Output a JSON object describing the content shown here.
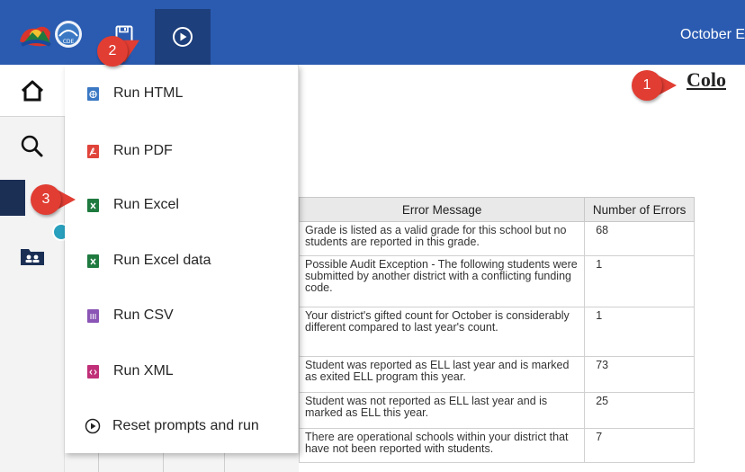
{
  "topbar": {
    "title": "October E",
    "logo_icon": "colorado-cde-logo-icon",
    "save_icon": "save-icon",
    "run_icon": "play-circle-icon"
  },
  "leftnav": {
    "items": [
      {
        "icon": "home-icon"
      },
      {
        "icon": "search-icon"
      },
      {
        "icon": "content-icon"
      },
      {
        "icon": "team-folder-icon"
      }
    ]
  },
  "page": {
    "heading": "Colo"
  },
  "run_menu": {
    "items": [
      {
        "label": "Run HTML",
        "icon": "html-file-icon"
      },
      {
        "label": "Run PDF",
        "icon": "pdf-file-icon"
      },
      {
        "label": "Run Excel",
        "icon": "excel-file-icon"
      },
      {
        "label": "Run Excel data",
        "icon": "excel-data-file-icon"
      },
      {
        "label": "Run CSV",
        "icon": "csv-file-icon"
      },
      {
        "label": "Run XML",
        "icon": "xml-file-icon"
      },
      {
        "label": "Reset prompts and run",
        "icon": "play-circle-icon"
      }
    ]
  },
  "table": {
    "headers": [
      "Error Message",
      "Number of Errors"
    ],
    "rows": [
      {
        "message": "Grade is listed as a valid grade for this school but no students are reported in this grade.",
        "count": "68"
      },
      {
        "message": "Possible Audit Exception - The following students were submitted by another district with a conflicting funding code.",
        "count": "1"
      },
      {
        "message": "Your district's gifted count for October is considerably different compared to last year's count.",
        "count": "1"
      },
      {
        "message": " Student was reported as ELL last year and is marked as exited ELL program this year.",
        "count": "73"
      },
      {
        "message": " Student was not reported as ELL last year and is marked as ELL this year.",
        "count": "25"
      },
      {
        "message": "There are operational schools within your district that have not been reported with students.",
        "count": "7"
      }
    ]
  },
  "callouts": [
    {
      "number": "1"
    },
    {
      "number": "2"
    },
    {
      "number": "3"
    }
  ],
  "colors": {
    "topbar": "#2a5bb1",
    "active_button": "#1d3f7c",
    "callout": "#e13d33",
    "excel": "#1f7a3f",
    "pdf": "#e0433a",
    "html": "#3b78c4",
    "csv": "#8a55b5",
    "xml": "#c02f78"
  }
}
